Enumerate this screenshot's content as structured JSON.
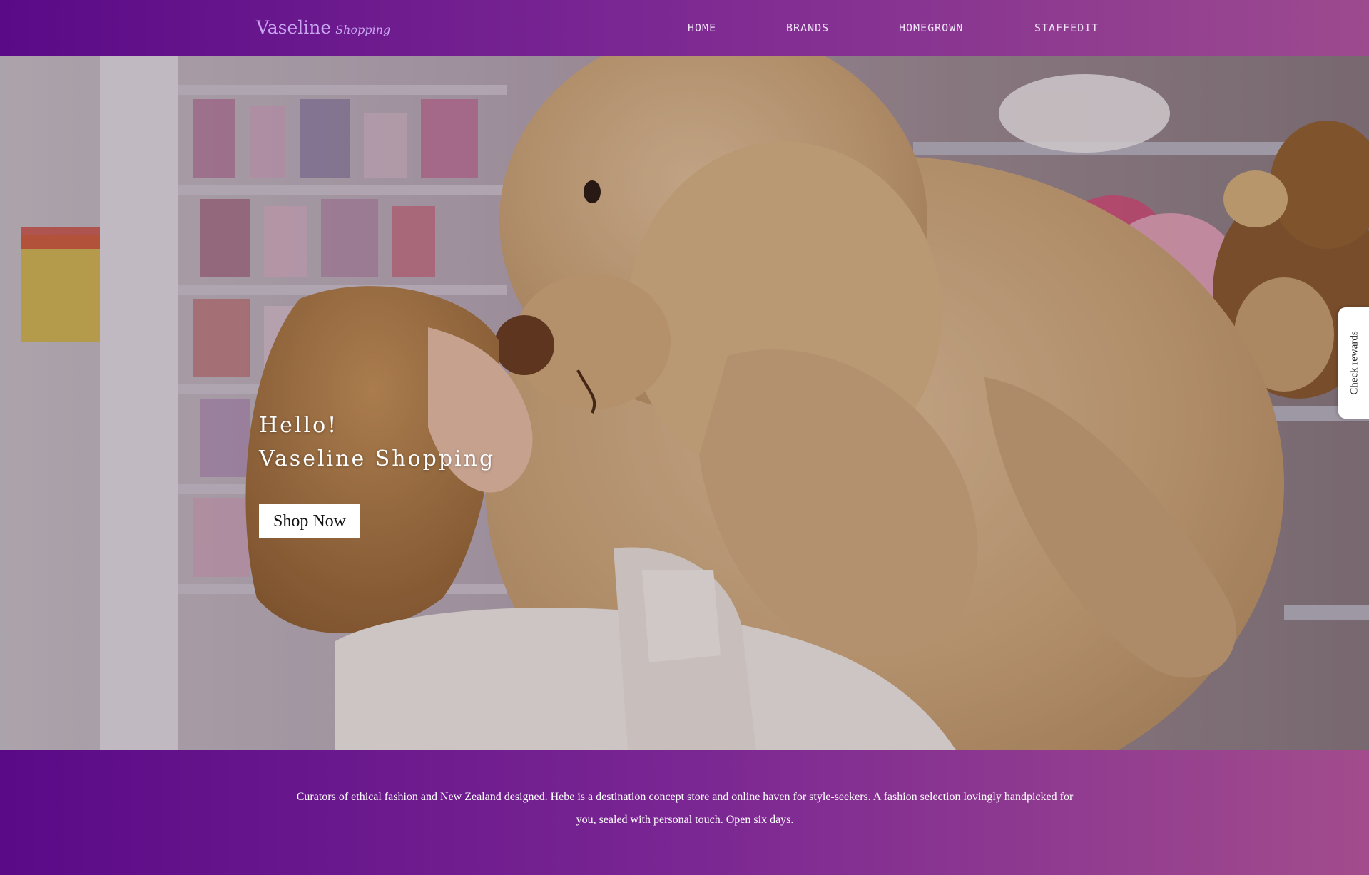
{
  "nav": {
    "logo_main": "Vaseline",
    "logo_sub": "Shopping",
    "links": [
      "HOME",
      "BRANDS",
      "HOMEGROWN",
      "STAFFEDIT"
    ]
  },
  "hero": {
    "greeting": "Hello!",
    "brand": "Vaseline Shopping",
    "cta_label": "Shop Now",
    "image_icon": "photo-icon"
  },
  "rewards": {
    "label": "Check rewards"
  },
  "footer": {
    "description": "Curators of ethical fashion and New Zealand designed. Hebe is a destination concept store and online haven for style-seekers. A fashion selection lovingly handpicked for you, sealed with personal touch. Open six days."
  },
  "colors": {
    "brand_purple": "#5a0a87",
    "brand_pink": "#a24c8d",
    "logo_lilac": "#c9a6f0"
  }
}
